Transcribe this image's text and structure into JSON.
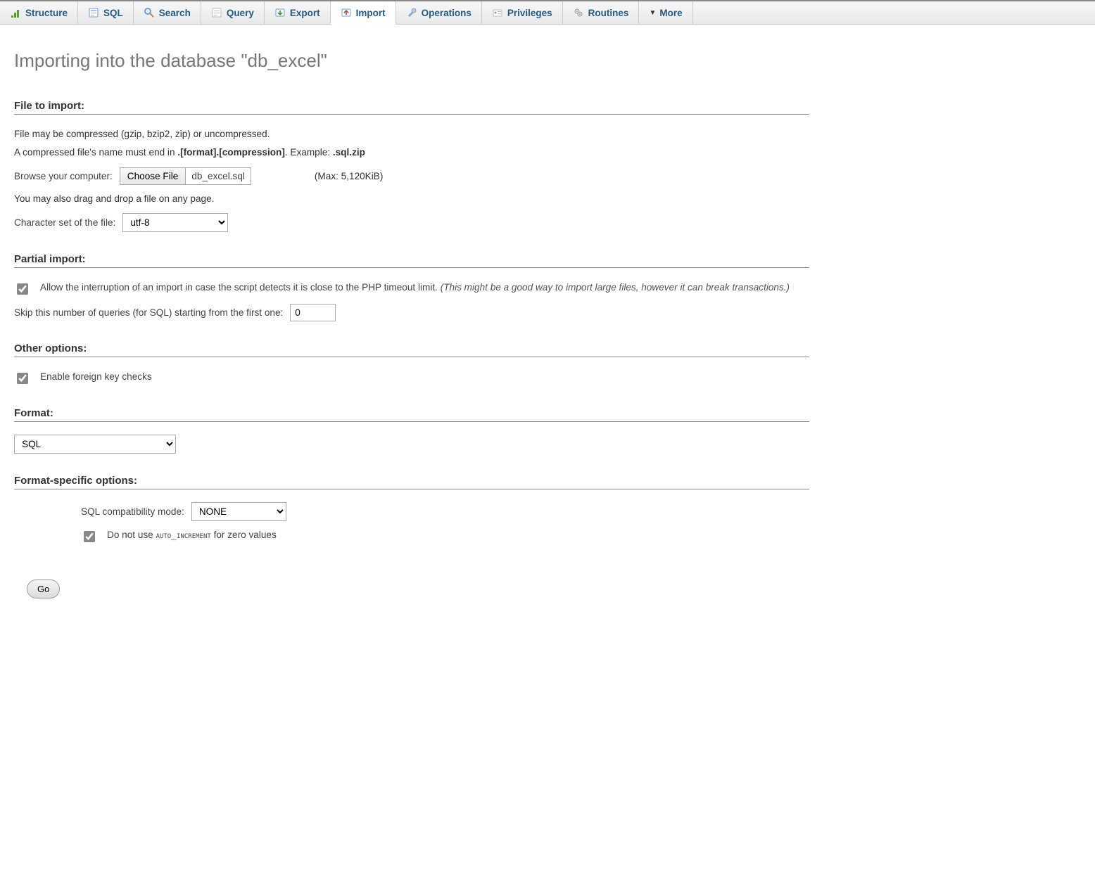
{
  "tabs": {
    "structure": "Structure",
    "sql": "SQL",
    "search": "Search",
    "query": "Query",
    "export": "Export",
    "import": "Import",
    "operations": "Operations",
    "privileges": "Privileges",
    "routines": "Routines",
    "more": "More"
  },
  "page_title": "Importing into the database \"db_excel\"",
  "sections": {
    "file_to_import": "File to import:",
    "partial_import": "Partial import:",
    "other_options": "Other options:",
    "format": "Format:",
    "format_specific": "Format-specific options:"
  },
  "file": {
    "compressed_line": "File may be compressed (gzip, bzip2, zip) or uncompressed.",
    "name_rule_prefix": "A compressed file's name must end in ",
    "name_rule_fmt": ".[format].[compression]",
    "name_rule_mid": ". Example: ",
    "name_rule_ex": ".sql.zip",
    "browse_label": "Browse your computer:",
    "choose_btn": "Choose File",
    "chosen_name": "db_excel.sql",
    "max_size": "(Max: 5,120KiB)",
    "dragdrop": "You may also drag and drop a file on any page.",
    "charset_label": "Character set of the file:",
    "charset_value": "utf-8"
  },
  "partial": {
    "allow_text": "Allow the interruption of an import in case the script detects it is close to the PHP timeout limit. ",
    "allow_note": "(This might be a good way to import large files, however it can break transactions.)",
    "skip_label": "Skip this number of queries (for SQL) starting from the first one:",
    "skip_value": "0"
  },
  "other": {
    "fk_label": "Enable foreign key checks"
  },
  "format_sel": "SQL",
  "fso": {
    "compat_label": "SQL compatibility mode:",
    "compat_value": "NONE",
    "no_auto_prefix": "Do not use ",
    "no_auto_code": "auto_increment",
    "no_auto_suffix": " for zero values"
  },
  "go_label": "Go"
}
